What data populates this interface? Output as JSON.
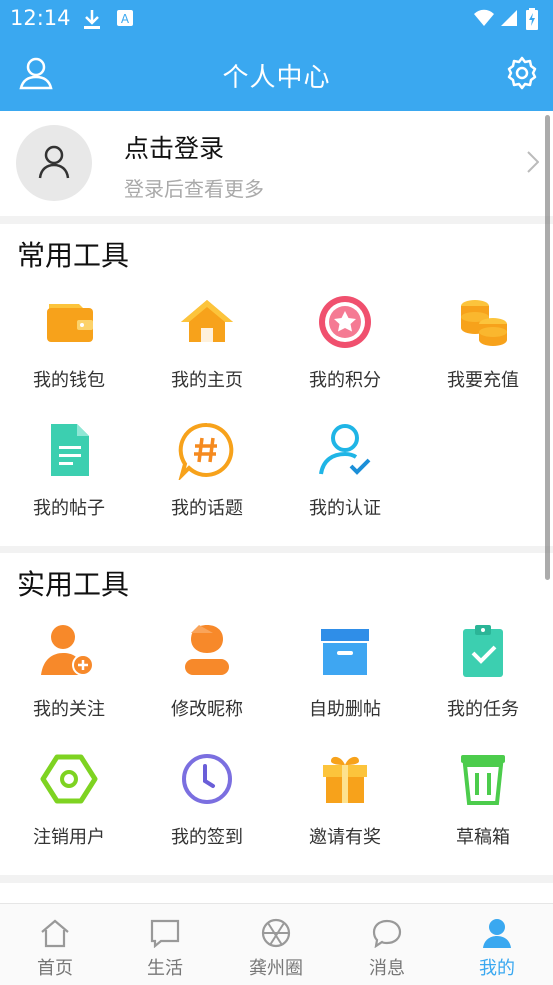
{
  "status": {
    "time": "12:14"
  },
  "header": {
    "title": "个人中心",
    "left_icon": "user-icon",
    "right_icon": "settings-gear-icon"
  },
  "profile": {
    "login_label": "点击登录",
    "login_hint": "登录后查看更多"
  },
  "common_tools": {
    "title": "常用工具",
    "items": [
      {
        "label": "我的钱包",
        "icon": "wallet-icon"
      },
      {
        "label": "我的主页",
        "icon": "home-icon"
      },
      {
        "label": "我的积分",
        "icon": "star-badge-icon"
      },
      {
        "label": "我要充值",
        "icon": "coins-icon"
      },
      {
        "label": "我的帖子",
        "icon": "document-icon"
      },
      {
        "label": "我的话题",
        "icon": "hashtag-bubble-icon"
      },
      {
        "label": "我的认证",
        "icon": "user-verified-icon"
      }
    ]
  },
  "practical_tools": {
    "title": "实用工具",
    "items": [
      {
        "label": "我的关注",
        "icon": "user-add-icon"
      },
      {
        "label": "修改昵称",
        "icon": "user-edit-icon"
      },
      {
        "label": "自助删帖",
        "icon": "archive-box-icon"
      },
      {
        "label": "我的任务",
        "icon": "clipboard-check-icon"
      },
      {
        "label": "注销用户",
        "icon": "hexagon-icon"
      },
      {
        "label": "我的签到",
        "icon": "clock-icon"
      },
      {
        "label": "邀请有奖",
        "icon": "gift-icon"
      },
      {
        "label": "草稿箱",
        "icon": "trash-icon"
      }
    ]
  },
  "tabs": [
    {
      "label": "首页",
      "icon": "home-outline-icon"
    },
    {
      "label": "生活",
      "icon": "chat-square-icon"
    },
    {
      "label": "龚州圈",
      "icon": "aperture-icon"
    },
    {
      "label": "消息",
      "icon": "message-bubble-icon"
    },
    {
      "label": "我的",
      "icon": "profile-filled-icon",
      "active": true
    }
  ],
  "colors": {
    "primary": "#3aa8f0",
    "orange": "#f7a21b",
    "red": "#f0506e"
  }
}
